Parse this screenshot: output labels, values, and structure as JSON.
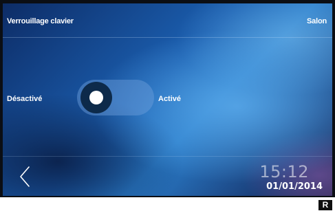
{
  "header": {
    "title": "Verrouillage clavier",
    "room": "Salon"
  },
  "toggle": {
    "off_label": "Désactivé",
    "on_label": "Activé",
    "state": "off"
  },
  "footer": {
    "back_icon": "chevron-left-icon",
    "time": "15:12",
    "date": "01/01/2014"
  },
  "badge": {
    "label": "R"
  }
}
